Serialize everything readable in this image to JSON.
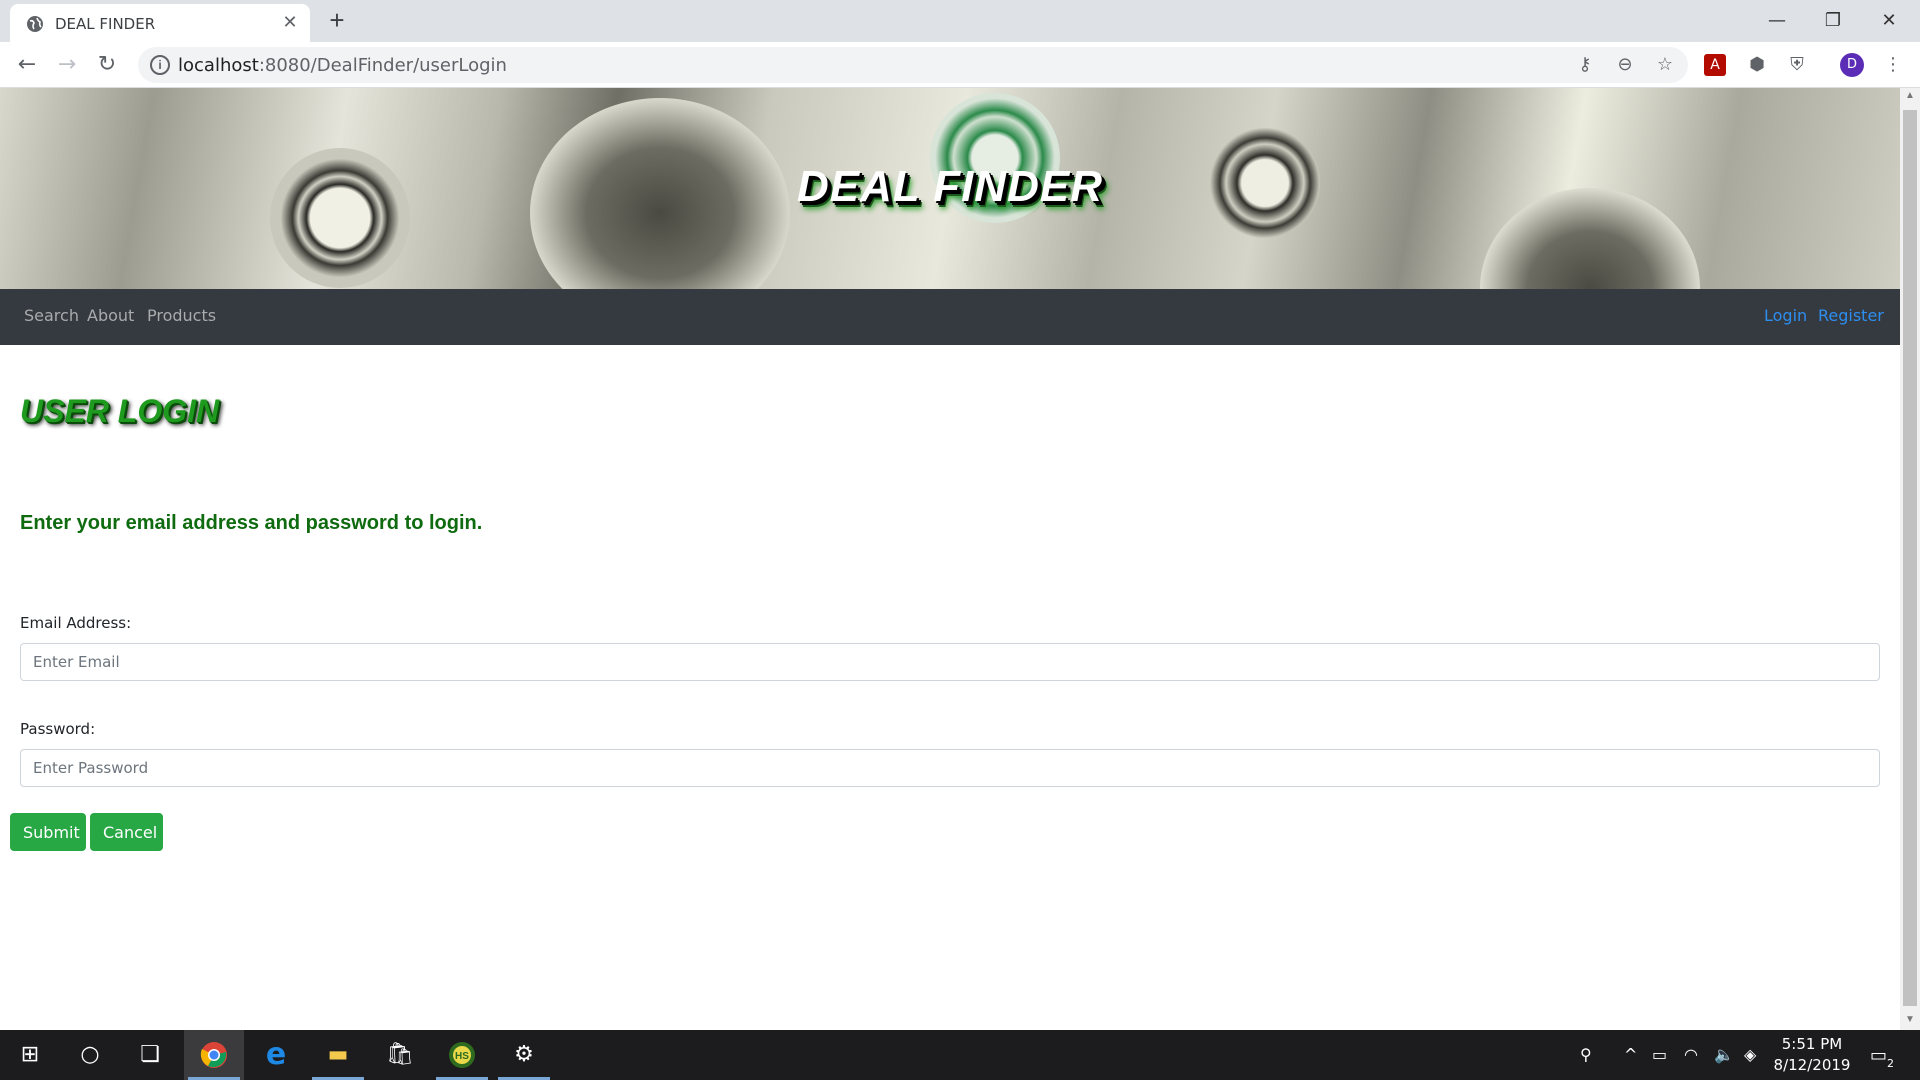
{
  "browser": {
    "tab_title": "DEAL FINDER",
    "new_tab_symbol": "+",
    "url_host": "localhost",
    "url_path": ":8080/DealFinder/userLogin",
    "profile_initial": "D",
    "icons": [
      "back-icon",
      "forward-icon",
      "reload-icon",
      "info-icon",
      "key-icon",
      "zoom-icon",
      "star-icon",
      "pdf-extension-icon",
      "ublock-extension-icon",
      "shield-extension-icon",
      "menu-icon"
    ]
  },
  "page": {
    "banner_title": "DEAL FINDER",
    "nav_left": [
      "Search",
      "About",
      "Products"
    ],
    "nav_right": [
      "Login",
      "Register"
    ],
    "heading": "USER LOGIN",
    "subheading": "Enter your email address and password to login.",
    "email": {
      "label": "Email Address:",
      "placeholder": "Enter Email",
      "value": ""
    },
    "password": {
      "label": "Password:",
      "placeholder": "Enter Password",
      "value": ""
    },
    "submit_label": "Submit",
    "cancel_label": "Cancel",
    "colors": {
      "navbar": "#343a40",
      "button": "#28a745",
      "heading_green": "#1e9a1e",
      "link_blue": "#2e8ef0"
    }
  },
  "taskbar": {
    "apps": [
      "windows-start-icon",
      "cortana-icon",
      "task-view-icon",
      "chrome-icon",
      "edge-icon",
      "file-explorer-icon",
      "store-icon",
      "hs-app-icon",
      "settings-gear-icon"
    ],
    "time": "5:51 PM",
    "date": "8/12/2019",
    "notification_count": "2"
  }
}
